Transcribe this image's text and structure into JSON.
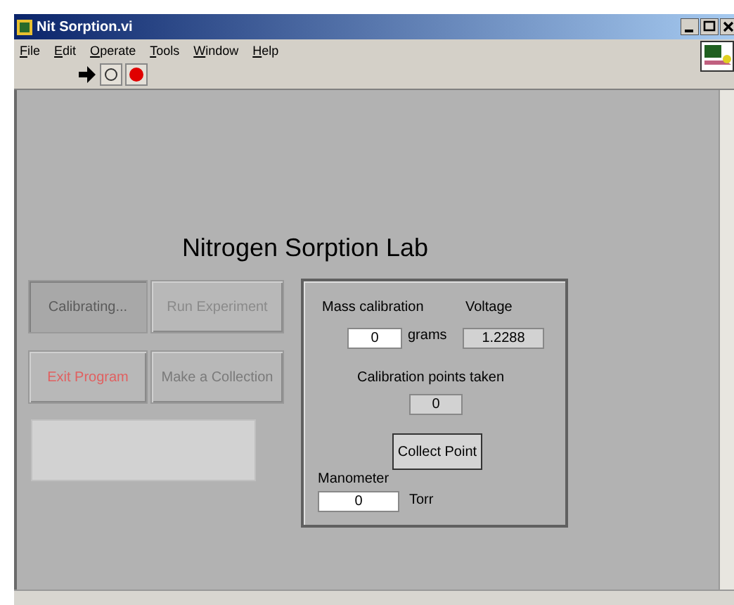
{
  "window": {
    "title": "Nit Sorption.vi"
  },
  "menu": [
    "File",
    "Edit",
    "Operate",
    "Tools",
    "Window",
    "Help"
  ],
  "panel": {
    "title": "Nitrogen Sorption Lab",
    "buttons": [
      {
        "label": "Calibrating...",
        "pressed": true,
        "color": "#5a5a5a"
      },
      {
        "label": "Run Experiment",
        "pressed": false,
        "color": "#8a8a8a"
      },
      {
        "label": "Exit Program",
        "pressed": false,
        "color": "#e06060"
      },
      {
        "label": "Make a Collection",
        "pressed": false,
        "color": "#7a7a7a"
      }
    ],
    "calibration": {
      "mass_label": "Mass calibration",
      "mass_value": "0",
      "mass_unit": "grams",
      "voltage_label": "Voltage",
      "voltage_value": "1.2288",
      "points_label": "Calibration points taken",
      "points_value": "0",
      "collect_button": "Collect Point",
      "manometer_label": "Manometer",
      "manometer_value": "0",
      "manometer_unit": "Torr"
    }
  }
}
